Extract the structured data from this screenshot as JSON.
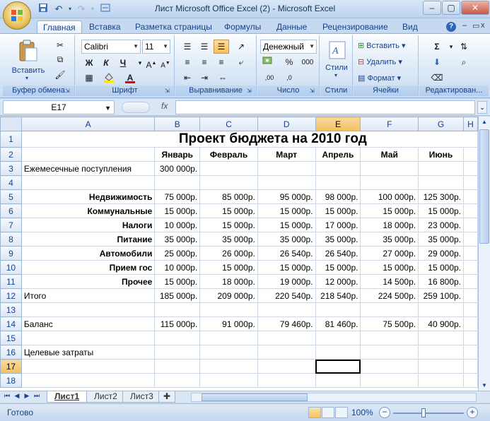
{
  "window": {
    "title": "Лист Microsoft Office Excel (2)  -  Microsoft Excel",
    "minimize": "–",
    "maximize": "▢",
    "close": "✕"
  },
  "tabs": [
    "Главная",
    "Вставка",
    "Разметка страницы",
    "Формулы",
    "Данные",
    "Рецензирование",
    "Вид"
  ],
  "ribbon": {
    "clipboard": {
      "paste": "Вставить",
      "label": "Буфер обмена"
    },
    "font": {
      "name": "Calibri",
      "size": "11",
      "bold": "Ж",
      "italic": "К",
      "underline": "Ч",
      "font_color_icon": "A",
      "label": "Шрифт"
    },
    "alignment": {
      "label": "Выравнивание"
    },
    "number": {
      "format": "Денежный",
      "percent": "%",
      "thousands": "000",
      "label": "Число"
    },
    "styles": {
      "label": "Стили"
    },
    "cells": {
      "insert": "Вставить",
      "delete": "Удалить",
      "format": "Формат",
      "label": "Ячейки"
    },
    "editing": {
      "label": "Редактирован..."
    }
  },
  "formula_bar": {
    "name_box": "E17",
    "fx": "fx",
    "formula": ""
  },
  "sheet": {
    "columns": [
      "A",
      "B",
      "C",
      "D",
      "E",
      "F",
      "G",
      "H"
    ],
    "selected_column": "E",
    "selected_row": "17",
    "title": "Проект бюджета на 2010 год",
    "months": [
      "Январь",
      "Февраль",
      "Март",
      "Апрель",
      "Май",
      "Июнь"
    ],
    "income_label": "Ежемесечные поступления",
    "income_value": "300 000р.",
    "expenses": [
      {
        "label": "Недвижимость",
        "values": [
          "75 000р.",
          "85 000р.",
          "95 000р.",
          "98 000р.",
          "100 000р.",
          "125 300р."
        ]
      },
      {
        "label": "Коммунальные",
        "values": [
          "15 000р.",
          "15 000р.",
          "15 000р.",
          "15 000р.",
          "15 000р.",
          "15 000р."
        ]
      },
      {
        "label": "Налоги",
        "values": [
          "10 000р.",
          "15 000р.",
          "15 000р.",
          "17 000р.",
          "18 000р.",
          "23 000р."
        ]
      },
      {
        "label": "Питание",
        "values": [
          "35 000р.",
          "35 000р.",
          "35 000р.",
          "35 000р.",
          "35 000р.",
          "35 000р."
        ]
      },
      {
        "label": "Автомобили",
        "values": [
          "25 000р.",
          "26 000р.",
          "26 540р.",
          "26 540р.",
          "27 000р.",
          "29 000р."
        ]
      },
      {
        "label": "Прием гос",
        "values": [
          "10 000р.",
          "15 000р.",
          "15 000р.",
          "15 000р.",
          "15 000р.",
          "15 000р."
        ]
      },
      {
        "label": "Прочее",
        "values": [
          "15 000р.",
          "18 000р.",
          "19 000р.",
          "12 000р.",
          "14 500р.",
          "16 800р."
        ]
      }
    ],
    "total_label": "Итого",
    "total_values": [
      "185 000р.",
      "209 000р.",
      "220 540р.",
      "218 540р.",
      "224 500р.",
      "259 100р."
    ],
    "balance_label": "Баланс",
    "balance_values": [
      "115 000р.",
      "91 000р.",
      "79 460р.",
      "81 460р.",
      "75 500р.",
      "40 900р."
    ],
    "target_label": "Целевые затраты",
    "row_numbers": [
      "1",
      "2",
      "3",
      "4",
      "5",
      "6",
      "7",
      "8",
      "9",
      "10",
      "11",
      "12",
      "13",
      "14",
      "15",
      "16",
      "17",
      "18"
    ]
  },
  "sheet_tabs": [
    "Лист1",
    "Лист2",
    "Лист3"
  ],
  "status": {
    "text": "Готово",
    "zoom": "100%"
  }
}
